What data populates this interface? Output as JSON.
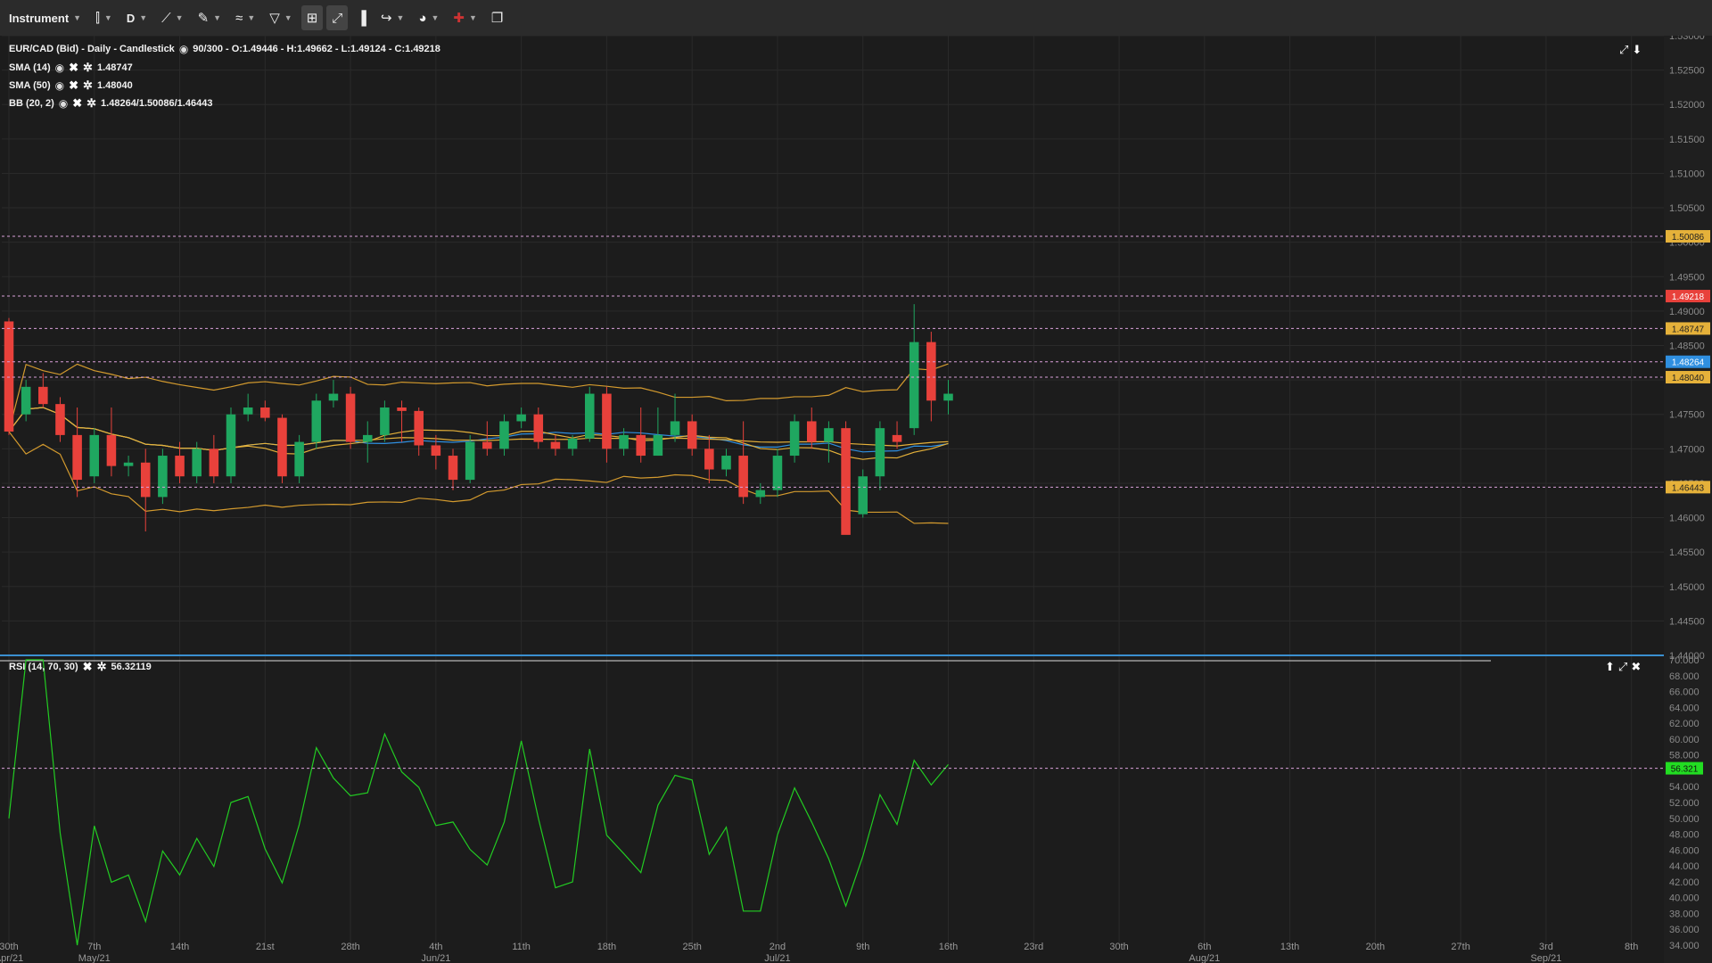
{
  "toolbar": {
    "instrument_label": "Instrument",
    "period_label": "D",
    "items": [
      "candlestick-icon",
      "line-tool-icon",
      "ruler-icon",
      "trend-icon",
      "shapes-icon",
      "layout-icon",
      "fullscreen-icon",
      "bar-chart-icon",
      "share-icon",
      "theme-icon",
      "flag-uk-icon",
      "window-icon"
    ]
  },
  "header": {
    "title": "EUR/CAD (Bid) - Daily - Candlestick",
    "ohlc": "90/300 - O:1.49446 - H:1.49662 - L:1.49124 - C:1.49218",
    "sma14_label": "SMA (14)",
    "sma14_value": "1.48747",
    "sma50_label": "SMA (50)",
    "sma50_value": "1.48040",
    "bb_label": "BB (20, 2)",
    "bb_value": "1.48264/1.50086/1.46443",
    "rsi_label": "RSI (14, 70, 30)",
    "rsi_value": "56.32119"
  },
  "colors": {
    "background": "#1c1c1c",
    "up": "#1fa760",
    "down": "#e8413b",
    "sma14": "#e5b13a",
    "sma50": "#e5b13a",
    "bb": "#d39a2e",
    "bb_mid": "#2f8fe0",
    "rsi": "#22cc22",
    "grid": "#2a2a2a"
  },
  "chart_data": [
    {
      "type": "candlestick",
      "instrument": "EUR/CAD (Bid)",
      "timeframe": "Daily",
      "ylim": [
        1.44,
        1.53
      ],
      "y_ticks": [
        "1.53000",
        "1.52500",
        "1.52000",
        "1.51500",
        "1.51000",
        "1.50500",
        "1.50000",
        "1.49500",
        "1.49000",
        "1.48500",
        "1.48000",
        "1.47500",
        "1.47000",
        "1.46500",
        "1.46000",
        "1.45500",
        "1.45000",
        "1.44500",
        "1.44000"
      ],
      "x_ticks": [
        {
          "i": 0,
          "label": "30th",
          "sub": "Apr/21"
        },
        {
          "i": 5,
          "label": "7th",
          "sub": "May/21"
        },
        {
          "i": 10,
          "label": "14th",
          "sub": ""
        },
        {
          "i": 15,
          "label": "21st",
          "sub": ""
        },
        {
          "i": 20,
          "label": "28th",
          "sub": ""
        },
        {
          "i": 25,
          "label": "4th",
          "sub": "Jun/21"
        },
        {
          "i": 30,
          "label": "11th",
          "sub": ""
        },
        {
          "i": 35,
          "label": "18th",
          "sub": ""
        },
        {
          "i": 40,
          "label": "25th",
          "sub": ""
        },
        {
          "i": 45,
          "label": "2nd",
          "sub": "Jul/21"
        },
        {
          "i": 50,
          "label": "9th",
          "sub": ""
        },
        {
          "i": 55,
          "label": "16th",
          "sub": ""
        },
        {
          "i": 60,
          "label": "23rd",
          "sub": ""
        },
        {
          "i": 65,
          "label": "30th",
          "sub": ""
        },
        {
          "i": 70,
          "label": "6th",
          "sub": "Aug/21"
        },
        {
          "i": 75,
          "label": "13th",
          "sub": ""
        },
        {
          "i": 80,
          "label": "20th",
          "sub": ""
        },
        {
          "i": 85,
          "label": "27th",
          "sub": ""
        },
        {
          "i": 90,
          "label": "3rd",
          "sub": "Sep/21"
        },
        {
          "i": 95,
          "label": "8th",
          "sub": ""
        }
      ],
      "price_labels": [
        {
          "value": 1.50086,
          "text": "1.50086",
          "color": "#e5b13a"
        },
        {
          "value": 1.49218,
          "text": "1.49218",
          "color": "#e8413b"
        },
        {
          "value": 1.48747,
          "text": "1.48747",
          "color": "#e5b13a"
        },
        {
          "value": 1.48264,
          "text": "1.48264",
          "color": "#2f8fe0"
        },
        {
          "value": 1.4804,
          "text": "1.48040",
          "color": "#e5b13a"
        },
        {
          "value": 1.46443,
          "text": "1.46443",
          "color": "#e5b13a"
        }
      ],
      "candles": [
        [
          1.4885,
          1.489,
          1.472,
          1.4725
        ],
        [
          1.475,
          1.48,
          1.474,
          1.479
        ],
        [
          1.479,
          1.481,
          1.476,
          1.4765
        ],
        [
          1.4765,
          1.4775,
          1.471,
          1.472
        ],
        [
          1.472,
          1.476,
          1.463,
          1.4655
        ],
        [
          1.466,
          1.473,
          1.465,
          1.472
        ],
        [
          1.472,
          1.476,
          1.466,
          1.4675
        ],
        [
          1.4675,
          1.469,
          1.466,
          1.468
        ],
        [
          1.468,
          1.47,
          1.458,
          1.463
        ],
        [
          1.463,
          1.47,
          1.462,
          1.469
        ],
        [
          1.469,
          1.471,
          1.465,
          1.466
        ],
        [
          1.466,
          1.471,
          1.465,
          1.47
        ],
        [
          1.47,
          1.472,
          1.465,
          1.466
        ],
        [
          1.466,
          1.476,
          1.465,
          1.475
        ],
        [
          1.475,
          1.478,
          1.474,
          1.476
        ],
        [
          1.476,
          1.477,
          1.474,
          1.4745
        ],
        [
          1.4745,
          1.475,
          1.465,
          1.466
        ],
        [
          1.466,
          1.472,
          1.465,
          1.471
        ],
        [
          1.471,
          1.478,
          1.47,
          1.477
        ],
        [
          1.477,
          1.48,
          1.476,
          1.478
        ],
        [
          1.478,
          1.479,
          1.47,
          1.471
        ],
        [
          1.471,
          1.474,
          1.468,
          1.472
        ],
        [
          1.472,
          1.477,
          1.471,
          1.476
        ],
        [
          1.476,
          1.477,
          1.471,
          1.4755
        ],
        [
          1.4755,
          1.476,
          1.469,
          1.4705
        ],
        [
          1.4705,
          1.472,
          1.467,
          1.469
        ],
        [
          1.469,
          1.47,
          1.464,
          1.4655
        ],
        [
          1.4655,
          1.472,
          1.465,
          1.471
        ],
        [
          1.471,
          1.474,
          1.469,
          1.47
        ],
        [
          1.47,
          1.475,
          1.469,
          1.474
        ],
        [
          1.474,
          1.476,
          1.473,
          1.475
        ],
        [
          1.475,
          1.476,
          1.47,
          1.471
        ],
        [
          1.471,
          1.472,
          1.469,
          1.47
        ],
        [
          1.47,
          1.472,
          1.469,
          1.4715
        ],
        [
          1.4715,
          1.479,
          1.471,
          1.478
        ],
        [
          1.478,
          1.479,
          1.468,
          1.47
        ],
        [
          1.47,
          1.473,
          1.469,
          1.472
        ],
        [
          1.472,
          1.476,
          1.468,
          1.469
        ],
        [
          1.469,
          1.476,
          1.469,
          1.472
        ],
        [
          1.472,
          1.478,
          1.471,
          1.474
        ],
        [
          1.474,
          1.475,
          1.469,
          1.47
        ],
        [
          1.47,
          1.472,
          1.465,
          1.467
        ],
        [
          1.467,
          1.47,
          1.466,
          1.469
        ],
        [
          1.469,
          1.474,
          1.462,
          1.463
        ],
        [
          1.463,
          1.465,
          1.462,
          1.464
        ],
        [
          1.464,
          1.47,
          1.463,
          1.469
        ],
        [
          1.469,
          1.475,
          1.468,
          1.474
        ],
        [
          1.474,
          1.476,
          1.47,
          1.471
        ],
        [
          1.471,
          1.474,
          1.468,
          1.473
        ],
        [
          1.473,
          1.474,
          1.458,
          1.4575
        ],
        [
          1.4605,
          1.467,
          1.46,
          1.466
        ],
        [
          1.466,
          1.474,
          1.464,
          1.473
        ],
        [
          1.472,
          1.474,
          1.47,
          1.471
        ],
        [
          1.473,
          1.491,
          1.472,
          1.4855
        ],
        [
          1.4855,
          1.487,
          1.474,
          1.477
        ],
        [
          1.477,
          1.48,
          1.475,
          1.478
        ]
      ],
      "rsi_ylim": [
        34,
        70
      ],
      "rsi_ticks": [
        "70.000",
        "68.000",
        "66.000",
        "64.000",
        "62.000",
        "60.000",
        "58.000",
        "56.000",
        "54.000",
        "52.000",
        "50.000",
        "48.000",
        "46.000",
        "44.000",
        "42.000",
        "40.000",
        "38.000",
        "36.000",
        "34.000"
      ],
      "rsi_level_label": "56.321",
      "rsi_level": 56.32
    }
  ]
}
